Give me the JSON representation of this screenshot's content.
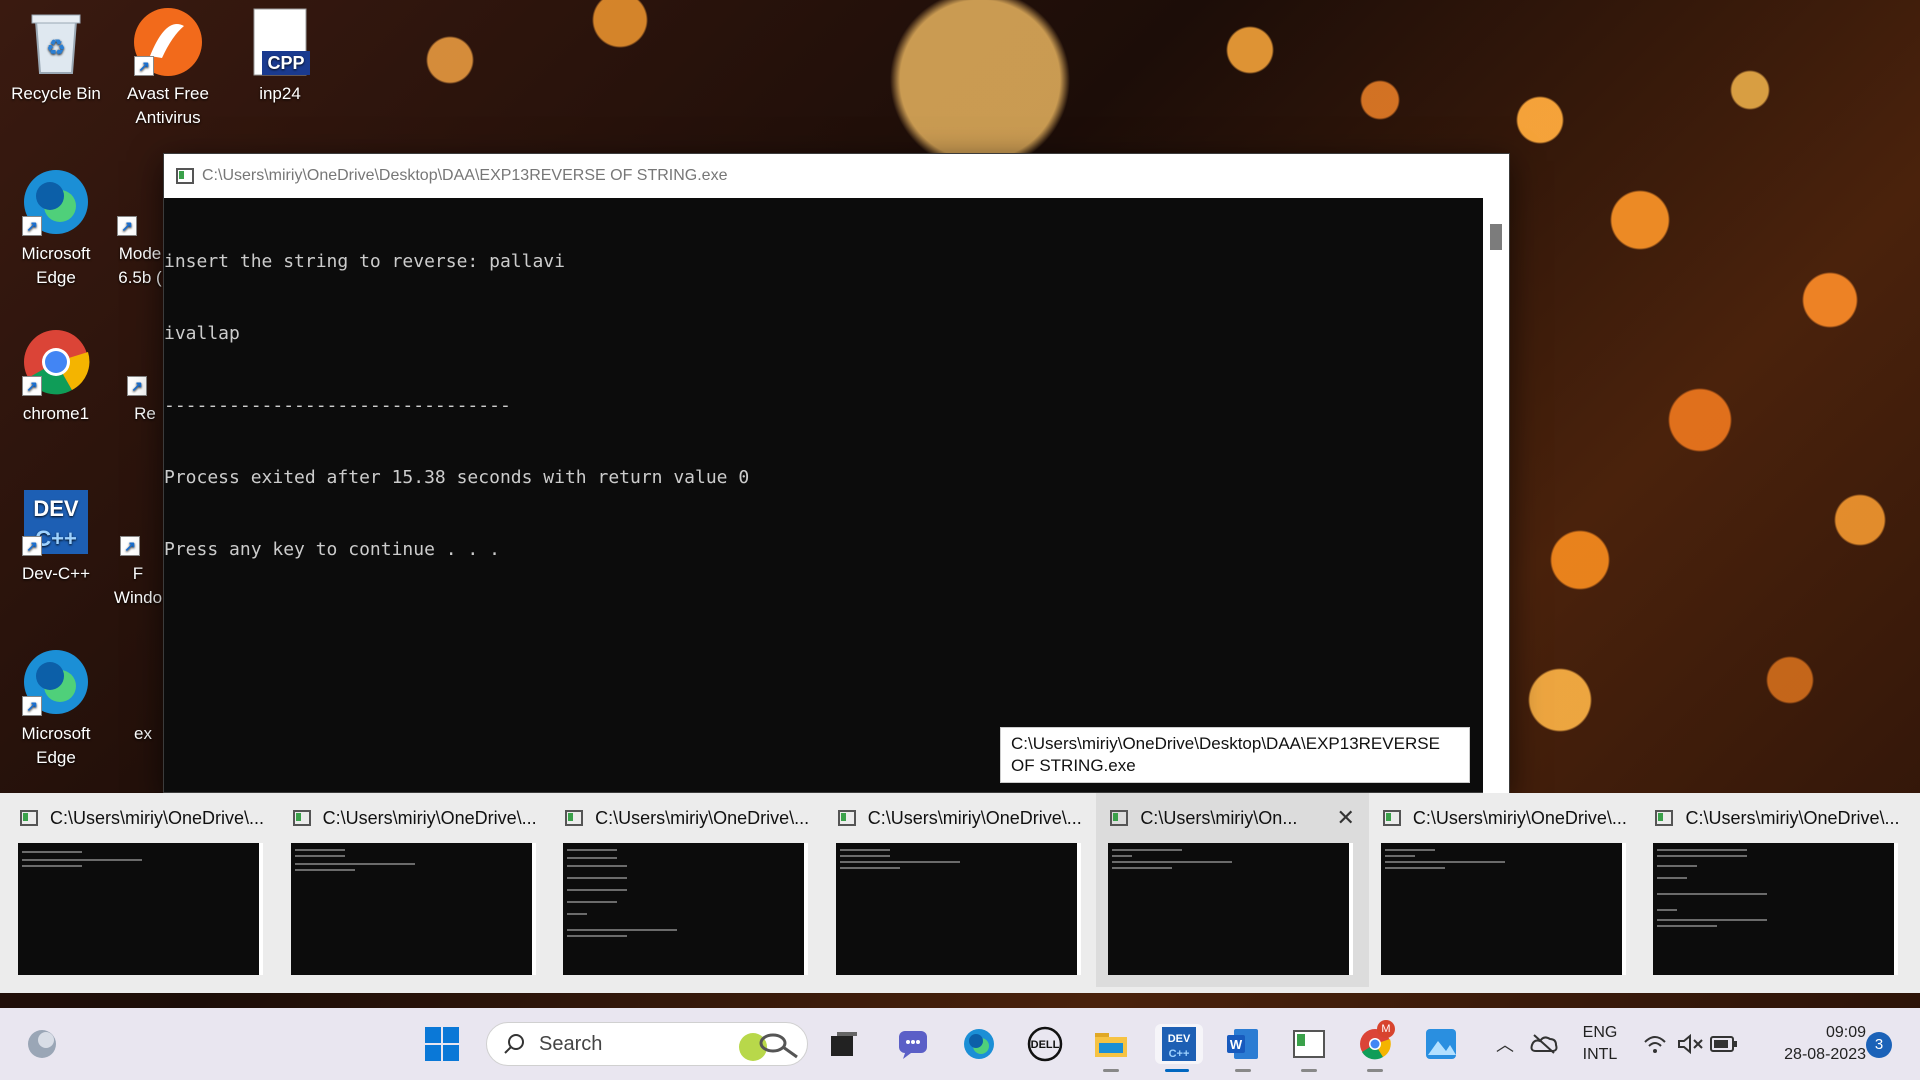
{
  "desktop_icons": [
    {
      "id": "recycle-bin",
      "label": "Recycle Bin"
    },
    {
      "id": "avast",
      "label": "Avast Free Antivirus"
    },
    {
      "id": "inp24",
      "label": "inp24",
      "badge": "CPP"
    },
    {
      "id": "edge-1",
      "label": "Microsoft Edge"
    },
    {
      "id": "mode",
      "label": "Mode 6.5b ("
    },
    {
      "id": "chrome1",
      "label": "chrome1"
    },
    {
      "id": "re",
      "label": "Re"
    },
    {
      "id": "devcpp",
      "label": "Dev-C++",
      "badge": "DEV"
    },
    {
      "id": "windo",
      "label": "F Windo"
    },
    {
      "id": "edge-2",
      "label": "Microsoft Edge"
    },
    {
      "id": "ex",
      "label": "ex"
    }
  ],
  "console": {
    "title": "C:\\Users\\miriy\\OneDrive\\Desktop\\DAA\\EXP13REVERSE OF STRING.exe",
    "lines": [
      "insert the string to reverse: pallavi",
      "ivallap",
      "--------------------------------",
      "Process exited after 15.38 seconds with return value 0",
      "Press any key to continue . . ."
    ]
  },
  "tooltip": "C:\\Users\\miriy\\OneDrive\\Desktop\\DAA\\EXP13REVERSE OF STRING.exe",
  "thumbnails": [
    {
      "title": "C:\\Users\\miriy\\OneDrive\\...",
      "active": false
    },
    {
      "title": "C:\\Users\\miriy\\OneDrive\\...",
      "active": false
    },
    {
      "title": "C:\\Users\\miriy\\OneDrive\\...",
      "active": false
    },
    {
      "title": "C:\\Users\\miriy\\OneDrive\\...",
      "active": false
    },
    {
      "title": "C:\\Users\\miriy\\On...",
      "active": true
    },
    {
      "title": "C:\\Users\\miriy\\OneDrive\\...",
      "active": false
    },
    {
      "title": "C:\\Users\\miriy\\OneDrive\\...",
      "active": false
    }
  ],
  "taskbar": {
    "search_placeholder": "Search",
    "language": "ENG",
    "layout": "INTL",
    "time": "09:09",
    "date": "28-08-2023",
    "notification_count": "3",
    "chrome_badge": "M",
    "devcpp_badge": "DEV"
  },
  "colors": {
    "console_bg": "#0c0c0c",
    "console_text": "#cccccc",
    "accent": "#0067c0"
  }
}
